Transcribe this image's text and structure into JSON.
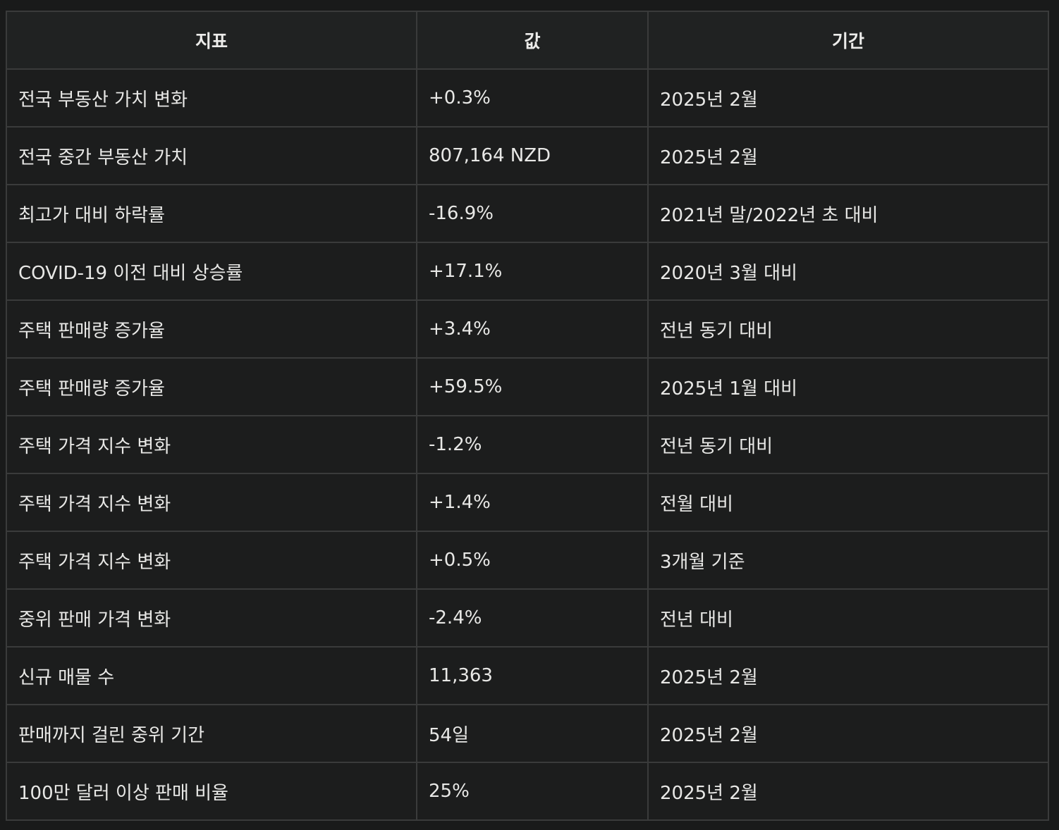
{
  "table": {
    "headers": [
      "지표",
      "값",
      "기간"
    ],
    "rows": [
      [
        "전국 부동산 가치 변화",
        "+0.3%",
        "2025년 2월"
      ],
      [
        "전국 중간 부동산 가치",
        "807,164 NZD",
        "2025년 2월"
      ],
      [
        "최고가 대비 하락률",
        "-16.9%",
        "2021년 말/2022년 초 대비"
      ],
      [
        "COVID-19 이전 대비 상승률",
        "+17.1%",
        "2020년 3월 대비"
      ],
      [
        "주택 판매량 증가율",
        "+3.4%",
        "전년 동기 대비"
      ],
      [
        "주택 판매량 증가율",
        "+59.5%",
        "2025년 1월 대비"
      ],
      [
        "주택 가격 지수 변화",
        "-1.2%",
        "전년 동기 대비"
      ],
      [
        "주택 가격 지수 변화",
        "+1.4%",
        "전월 대비"
      ],
      [
        "주택 가격 지수 변화",
        "+0.5%",
        "3개월 기준"
      ],
      [
        "중위 판매 가격 변화",
        "-2.4%",
        "전년 대비"
      ],
      [
        "신규 매물 수",
        "11,363",
        "2025년 2월"
      ],
      [
        "판매까지 걸린 중위 기간",
        "54일",
        "2025년 2월"
      ],
      [
        "100만 달러 이상 판매 비율",
        "25%",
        "2025년 2월"
      ]
    ]
  }
}
